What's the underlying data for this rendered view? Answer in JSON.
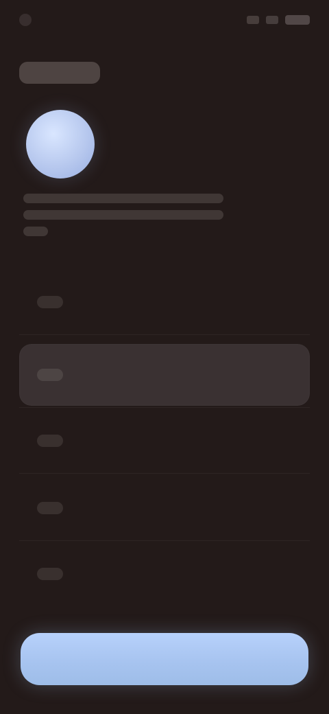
{
  "statusbar": {
    "time": "",
    "icons": [
      "signal-icon",
      "wifi-icon",
      "battery-icon"
    ]
  },
  "header": {
    "title": ""
  },
  "profile": {
    "avatar_icon": "avatar-icon",
    "description_lines": [
      "",
      "",
      ""
    ]
  },
  "list": {
    "items": [
      {
        "label": "",
        "selected": false
      },
      {
        "label": "",
        "selected": true
      },
      {
        "label": "",
        "selected": false
      },
      {
        "label": "",
        "selected": false
      },
      {
        "label": "",
        "selected": false
      }
    ]
  },
  "actions": {
    "primary_label": ""
  },
  "colors": {
    "background": "#231a19",
    "accent": "#a9c6f0",
    "highlight": "#3a3132"
  }
}
